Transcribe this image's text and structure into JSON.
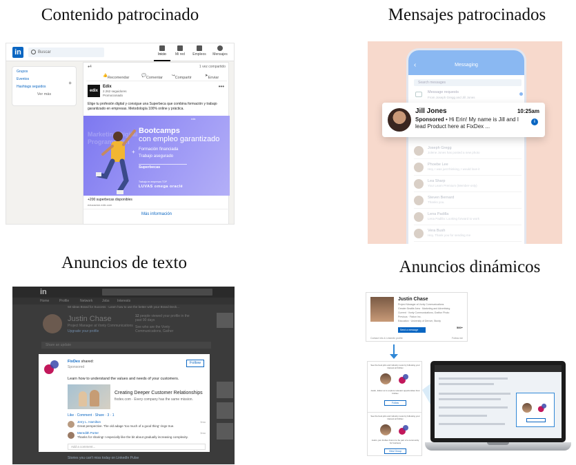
{
  "titles": {
    "sponsored_content": "Contenido patrocinado",
    "sponsored_messages": "Mensajes patrocinados",
    "text_ads": "Anuncios de texto",
    "dynamic_ads": "Anuncios dinámicos"
  },
  "sponsored_content": {
    "logo": "in",
    "search_placeholder": "Buscar",
    "nav": [
      {
        "label": "Inicio",
        "icon": "home-icon"
      },
      {
        "label": "Mi red",
        "icon": "network-icon"
      },
      {
        "label": "Empleos",
        "icon": "briefcase-icon"
      },
      {
        "label": "Mensajes",
        "icon": "chat-icon"
      }
    ],
    "left_links": [
      "Grupos",
      "Eventos",
      "Hashtags seguidos"
    ],
    "left_more": "Ver más",
    "shares": "1 vez compartido",
    "actions": [
      "Recomendar",
      "Comentar",
      "Compartir",
      "Enviar"
    ],
    "advertiser": {
      "logo": "edix",
      "name": "Edix",
      "followers": "2.262 seguidores",
      "promoted": "Promocionado"
    },
    "ad_text": "Elige tu profesión digital y consigue una Superbeca que combina formación y trabajo garantizado en empresas. Metodología 100% online y práctica.",
    "hero": {
      "title": "Bootcamps",
      "subtitle": "con empleo garantizado",
      "features": [
        "Formación financiada",
        "Trabajo asegurado"
      ],
      "brand": "Superbecas",
      "partners_label": "Trabaja en empresas TOP",
      "partners": "LUVAS  omega  oraclé"
    },
    "caption": "+200 superbecas disponibles",
    "url": "educacion.edix.com",
    "cta": "Más información"
  },
  "sponsored_messages": {
    "header": "Messaging",
    "search_placeholder": "Search messages",
    "requests_title": "Message requests",
    "requests_sub": "From Joseph Gregg and Jill Jones",
    "notification": {
      "name": "Jill Jones",
      "time": "10:25am",
      "label": "Sponsored",
      "message": " • Hi Erin! My name is Jill and I lead Product here at FixDex ...",
      "badge": "i"
    },
    "conversations": [
      {
        "name": "Joseph Gregg",
        "msg": "Jolene Jones has posted a new photo"
      },
      {
        "name": "Phoebe Lee",
        "msg": "Hey, I was just thinking, I would love it"
      },
      {
        "name": "Lea Sharp",
        "msg": "Your Learn Premium (Member-only)"
      },
      {
        "name": "Steven Bernard",
        "msg": "Thanks you."
      },
      {
        "name": "Lena Padilla",
        "msg": "Lena Padilla: Looking forward to work"
      },
      {
        "name": "Vera Bush",
        "msg": "Hey, Thank you for sending me"
      }
    ]
  },
  "text_ads": {
    "logo": "in",
    "nav": [
      "Home",
      "Profile",
      "Network",
      "Jobs",
      "Interests"
    ],
    "notice": "50 Ideas Brand for Success · Learn how to use the better with your Brand Deck...",
    "profile": {
      "name": "Justin Chase",
      "title": "Project Manager at Vonty Communications",
      "upgrade": "Upgrade your profile",
      "views_count": "12",
      "views_label": "people viewed your profile in the past 90 days",
      "stat2": "See who are the Vonty Communications, Gather"
    },
    "share_placeholder": "Share an update",
    "post": {
      "company": "FixDex",
      "action": " shared:",
      "sponsored": "Sponsored",
      "follow": "Follow",
      "text": "Learn how to understand the values and needs of your customers.",
      "article_title": "Creating Deeper Customer Relationships",
      "article_sub": "fixdex.com  ·  Every company has the same mission.",
      "social": "Like  ·  Comment  ·  Share  ·  3  ·  1",
      "comments": [
        {
          "name": "Jerry L. Hamilton",
          "text": "Great perspective. The old adage 'too much of a good thing' rings true.",
          "date": "3mo"
        },
        {
          "name": "Meredith Porter",
          "text": "Thanks for sharing! I especially like the bit about gradually increasing complexity.",
          "date": "3mo"
        }
      ],
      "add_comment": "Add a comment..."
    },
    "bottom": "Stories you can't miss today on LinkedIn Pulse"
  },
  "dynamic_ads": {
    "card": {
      "name": "Justin Chase",
      "lines": [
        "Project Manager at Vonty Communications",
        "Greater Seattle Area  ·  Marketing and Advertising",
        "Current  ·  Vonty Communications, Grafton Photo",
        "Previous  ·  Fiction Inc.",
        "Education  ·  University of Denver, Sturdy"
      ],
      "send": "Send a message",
      "connections": "500+",
      "footer_left": "Contact info & LinkedIn profile",
      "footer_right": "Follow me"
    },
    "mini1": {
      "text": "See the best jobs and industry news by following your interest at FixDex",
      "caption": "Justin, follow us to explore relevant opportunities from FixDex",
      "button": "Follow"
    },
    "mini2": {
      "text": "See the best jobs and industry news by following your interest at FixDex",
      "caption": "Justin, join FixDex Forum to be part of a community for business",
      "button": "View Group"
    }
  },
  "colors": {
    "linkedin_blue": "#0a66c2",
    "hero_purple": "#8d88f3",
    "messages_bg": "#f7d9cc",
    "arrow_blue": "#2f87d6"
  }
}
